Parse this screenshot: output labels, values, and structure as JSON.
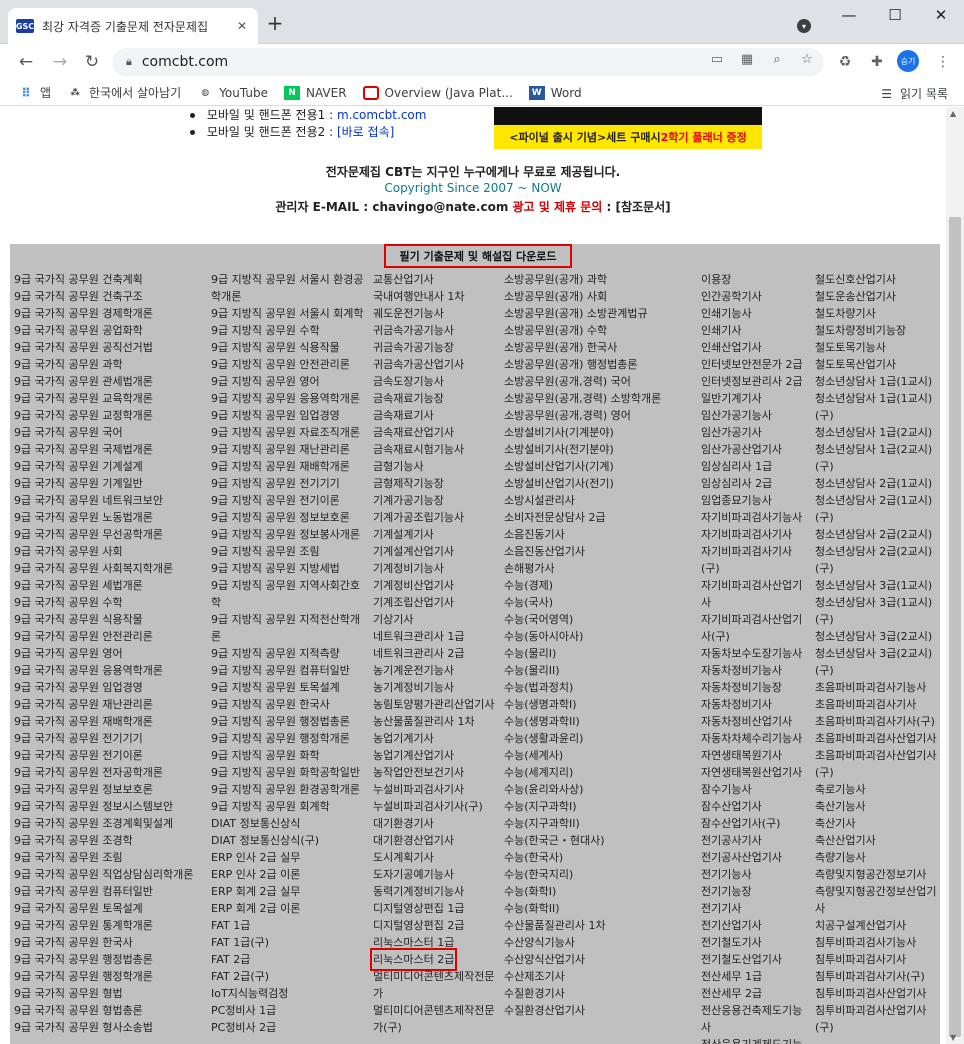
{
  "browser": {
    "tab_title": "최강 자격증 기출문제 전자문제집",
    "favicon_text": "GSC",
    "url": "comcbt.com",
    "new_tab": "+",
    "profile": "승기"
  },
  "bookmarks": {
    "items": [
      "앱",
      "한국에서 살아남기",
      "YouTube",
      "NAVER",
      "Overview (Java Plat...",
      "Word"
    ],
    "reading_list": "읽기 목록"
  },
  "page": {
    "mobile_lines": [
      {
        "prefix": "모바일 및 핸드폰 전용1 : ",
        "link": "m.comcbt.com"
      },
      {
        "prefix": "모바일 및 핸드폰 전용2 : ",
        "link": "[바로 접속]"
      }
    ],
    "banner_text_left": "<파이널 출시 기념>",
    "banner_text_mid": " 세트 구매시 ",
    "banner_text_right": "2학기 플래너 증정",
    "free_notice": "전자문제집 CBT는 지구인 누구에게나 무료로 제공됩니다.",
    "since": "Copyright Since 2007 ~ NOW",
    "admin_prefix": "관리자 E-MAIL : chavingo@nate.com ",
    "admin_ad": "광고 및 제휴 문의",
    "admin_suffix": " : [참조문서]",
    "list_title": "필기 기출문제 및 해설집 다운로드"
  },
  "columns": [
    [
      "9급 국가직 공무원 건축계획",
      "9급 국가직 공무원 건축구조",
      "9급 국가직 공무원 경제학개론",
      "9급 국가직 공무원 공업화학",
      "9급 국가직 공무원 공직선거법",
      "9급 국가직 공무원 과학",
      "9급 국가직 공무원 관세법개론",
      "9급 국가직 공무원 교육학개론",
      "9급 국가직 공무원 교정학개론",
      "9급 국가직 공무원 국어",
      "9급 국가직 공무원 국제법개론",
      "9급 국가직 공무원 기계설계",
      "9급 국가직 공무원 기계일반",
      "9급 국가직 공무원 네트워크보안",
      "9급 국가직 공무원 노동법개론",
      "9급 국가직 공무원 무선공학개론",
      "9급 국가직 공무원 사회",
      "9급 국가직 공무원 사회복지학개론",
      "9급 국가직 공무원 세법개론",
      "9급 국가직 공무원 수학",
      "9급 국가직 공무원 식용작물",
      "9급 국가직 공무원 안전관리론",
      "9급 국가직 공무원 영어",
      "9급 국가직 공무원 응용역학개론",
      "9급 국가직 공무원 임업경영",
      "9급 국가직 공무원 재난관리론",
      "9급 국가직 공무원 재배학개론",
      "9급 국가직 공무원 전기기기",
      "9급 국가직 공무원 전기이론",
      "9급 국가직 공무원 전자공학개론",
      "9급 국가직 공무원 정보보호론",
      "9급 국가직 공무원 정보시스템보안",
      "9급 국가직 공무원 조경계획및설계",
      "9급 국가직 공무원 조경학",
      "9급 국가직 공무원 조림",
      "9급 국가직 공무원 직업상담심리학개론",
      "9급 국가직 공무원 컴퓨터일반",
      "9급 국가직 공무원 토목설계",
      "9급 국가직 공무원 통계학개론",
      "9급 국가직 공무원 한국사",
      "9급 국가직 공무원 행정법총론",
      "9급 국가직 공무원 행정학개론",
      "9급 국가직 공무원 형법",
      "9급 국가직 공무원 형법총론",
      "9급 국가직 공무원 형사소송법"
    ],
    [
      "9급 지방직 공무원 서울시 환경공학개론",
      "9급 지방직 공무원 서울시 회계학",
      "9급 지방직 공무원 수학",
      "9급 지방직 공무원 식용작물",
      "9급 지방직 공무원 안전관리론",
      "9급 지방직 공무원 영어",
      "9급 지방직 공무원 응용역학개론",
      "9급 지방직 공무원 임업경영",
      "9급 지방직 공무원 자료조직개론",
      "9급 지방직 공무원 재난관리론",
      "9급 지방직 공무원 재배학개론",
      "9급 지방직 공무원 전기기기",
      "9급 지방직 공무원 전기이론",
      "9급 지방직 공무원 정보보호론",
      "9급 지방직 공무원 정보봉사개론",
      "9급 지방직 공무원 조림",
      "9급 지방직 공무원 지방세법",
      "9급 지방직 공무원 지역사회간호학",
      "9급 지방직 공무원 지적전산학개론",
      "9급 지방직 공무원 지적측량",
      "9급 지방직 공무원 컴퓨터일반",
      "9급 지방직 공무원 토목설계",
      "9급 지방직 공무원 한국사",
      "9급 지방직 공무원 행정법총론",
      "9급 지방직 공무원 행정학개론",
      "9급 지방직 공무원 화학",
      "9급 지방직 공무원 화학공학일반",
      "9급 지방직 공무원 환경공학개론",
      "9급 지방직 공무원 회계학",
      "DIAT 정보통신상식",
      "DIAT 정보통신상식(구)",
      "ERP 인사 2급 실무",
      "ERP 인사 2급 이론",
      "ERP 회계 2급 실무",
      "ERP 회계 2급 이론",
      "FAT 1급",
      "FAT 1급(구)",
      "FAT 2급",
      "FAT 2급(구)",
      "IoT지식능력검정",
      "PC정비사 1급",
      "PC정비사 2급"
    ],
    [
      "교통산업기사",
      "국내여행안내사 1차",
      "궤도운전기능사",
      "귀금속가공기능사",
      "귀금속가공기능장",
      "귀금속가공산업기사",
      "금속도장기능사",
      "금속재료기능장",
      "금속재료기사",
      "금속재료산업기사",
      "금속재료시험기능사",
      "금형기능사",
      "금형제작기능장",
      "기계가공기능장",
      "기계가공조립기능사",
      "기계설계기사",
      "기계설계산업기사",
      "기계정비기능사",
      "기계정비산업기사",
      "기계조립산업기사",
      "기상기사",
      "네트워크관리사 1급",
      "네트워크관리사 2급",
      "농기계운전기능사",
      "농기계정비기능사",
      "농림토양평가관리산업기사",
      "농산물품질관리사 1차",
      "농업기계기사",
      "농업기계산업기사",
      "농작업안전보건기사",
      "누설비파괴검사기사",
      "누설비파괴검사기사(구)",
      "대기환경기사",
      "대기환경산업기사",
      "도시계획기사",
      "도자기공예기능사",
      "동력기계정비기능사",
      "디지털영상편집 1급",
      "디지털영상편집 2급",
      "리눅스마스터 1급",
      "리눅스마스터 2급",
      "멀티미디어콘텐츠제작전문가",
      "멀티미디어콘텐츠제작전문가(구)"
    ],
    [
      "소방공무원(공개) 과학",
      "소방공무원(공개) 사회",
      "소방공무원(공개) 소방관계법규",
      "소방공무원(공개) 수학",
      "소방공무원(공개) 한국사",
      "소방공무원(공개) 행정법총론",
      "소방공무원(공개,경력) 국어",
      "소방공무원(공개,경력) 소방학개론",
      "소방공무원(공개,경력) 영어",
      "소방설비기사(기계분야)",
      "소방설비기사(전기분야)",
      "소방설비산업기사(기계)",
      "소방설비산업기사(전기)",
      "소방시설관리사",
      "소비자전문상담사 2급",
      "소음진동기사",
      "소음진동산업기사",
      "손해평가사",
      "수능(경제)",
      "수능(국사)",
      "수능(국어영역)",
      "수능(동아시아사)",
      "수능(물리I)",
      "수능(물리II)",
      "수능(법과정치)",
      "수능(생명과학I)",
      "수능(생명과학II)",
      "수능(생활과윤리)",
      "수능(세계사)",
      "수능(세계지리)",
      "수능(윤리와사상)",
      "수능(지구과학I)",
      "수능(지구과학II)",
      "수능(한국근・현대사)",
      "수능(한국사)",
      "수능(한국지리)",
      "수능(화학I)",
      "수능(화학II)",
      "수산물품질관리사 1차",
      "수산양식기능사",
      "수산양식산업기사",
      "수산제조기사",
      "수질환경기사",
      "수질환경산업기사"
    ],
    [
      "이용장",
      "인간공학기사",
      "인쇄기능사",
      "인쇄기사",
      "인쇄산업기사",
      "인터넷보안전문가 2급",
      "인터넷정보관리사 2급",
      "일반기계기사",
      "임산가공기능사",
      "임산가공기사",
      "임산가공산업기사",
      "임상심리사 1급",
      "임상심리사 2급",
      "임업종묘기능사",
      "자기비파괴검사기능사",
      "자기비파괴검사기사",
      "자기비파괴검사기사(구)",
      "자기비파괴검사산업기사",
      "자기비파괴검사산업기사(구)",
      "자동차보수도장기능사",
      "자동차정비기능사",
      "자동차정비기능장",
      "자동차정비기사",
      "자동차정비산업기사",
      "자동차차체수리기능사",
      "자연생태복원기사",
      "자연생태복원산업기사",
      "잠수기능사",
      "잠수산업기사",
      "잠수산업기사(구)",
      "전기공사기사",
      "전기공사산업기사",
      "전기기능사",
      "전기기능장",
      "전기기사",
      "전기산업기사",
      "전기철도기사",
      "전기철도산업기사",
      "전산세무 1급",
      "전산세무 2급",
      "전산응용건축제도기능사",
      "전산응용기계제도기능사"
    ],
    [
      "철도신호산업기사",
      "철도운송산업기사",
      "철도차량기사",
      "철도차량정비기능장",
      "철도토목기능사",
      "철도토목산업기사",
      "청소년상담사 1급(1교시)",
      "청소년상담사 1급(1교시)(구)",
      "청소년상담사 1급(2교시)",
      "청소년상담사 1급(2교시)(구)",
      "청소년상담사 2급(1교시)",
      "청소년상담사 2급(1교시)(구)",
      "청소년상담사 2급(2교시)",
      "청소년상담사 2급(2교시)(구)",
      "청소년상담사 3급(1교시)",
      "청소년상담사 3급(1교시)(구)",
      "청소년상담사 3급(2교시)",
      "청소년상담사 3급(2교시)(구)",
      "초음파비파괴검사기능사",
      "초음파비파괴검사기사",
      "초음파비파괴검사기사(구)",
      "초음파비파괴검사산업기사",
      "초음파비파괴검사산업기사(구)",
      "축로기능사",
      "축산기능사",
      "축산기사",
      "축산산업기사",
      "측량기능사",
      "측량및지형공간정보기사",
      "측량및지형공간정보산업기사",
      "치공구설계산업기사",
      "침투비파괴검사기능사",
      "침투비파괴검사기사",
      "침투비파괴검사기사(구)",
      "침투비파괴검사산업기사",
      "침투비파괴검사산업기사(구)"
    ]
  ]
}
